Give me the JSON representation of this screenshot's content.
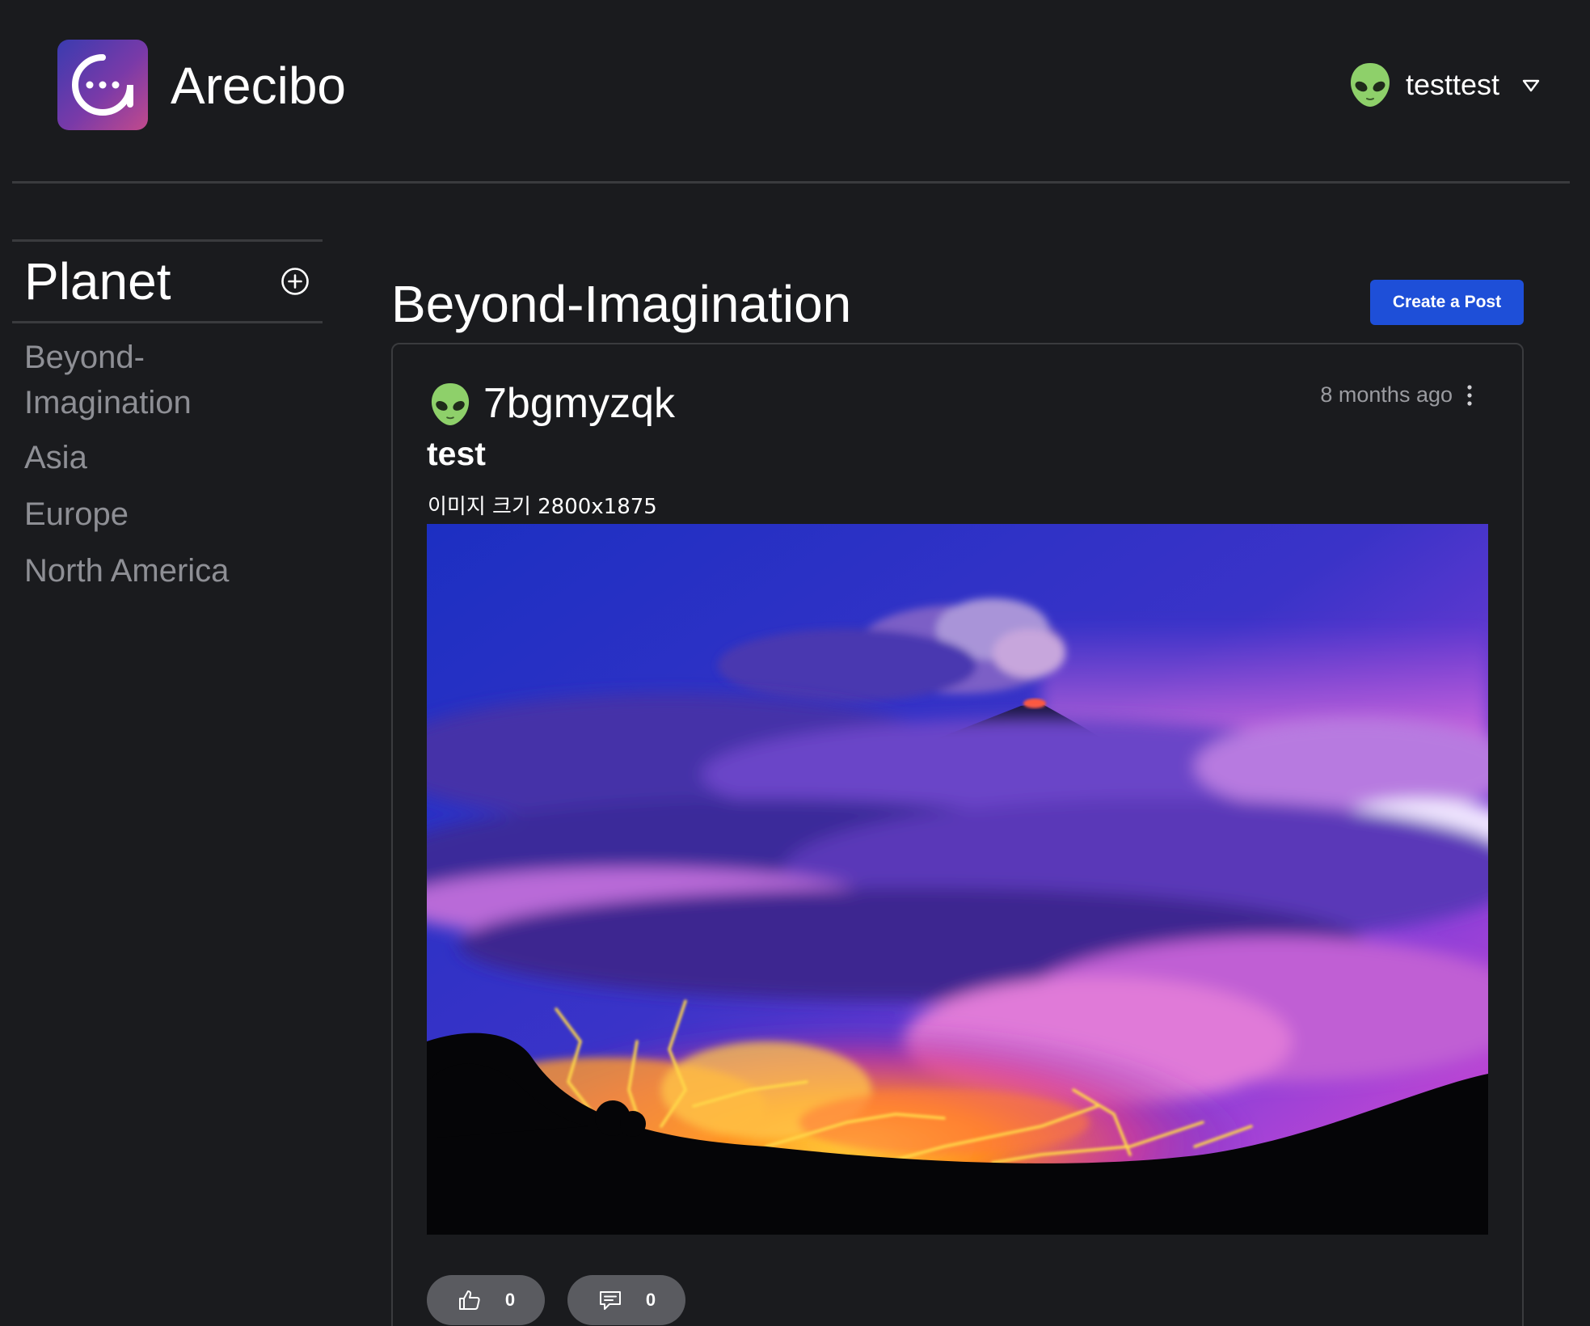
{
  "app": {
    "name": "Arecibo",
    "logo_icon": "chat-bubble-at-icon",
    "brand_gradient": [
      "#3a3bb0",
      "#7a3aa8",
      "#c24a8c"
    ]
  },
  "user": {
    "name": "testtest",
    "avatar_icon": "alien-face-icon",
    "menu_icon": "chevron-down-icon"
  },
  "sidebar": {
    "title": "Planet",
    "add_icon": "plus-circle-icon",
    "items": [
      {
        "label": "Beyond-\nImagination"
      },
      {
        "label": "Asia"
      },
      {
        "label": "Europe"
      },
      {
        "label": "North America"
      }
    ]
  },
  "main": {
    "title": "Beyond-Imagination",
    "create_button": "Create a Post",
    "accent": "#1e4fd8"
  },
  "post": {
    "author": "7bgmyzqk",
    "author_avatar_icon": "alien-face-icon",
    "timestamp": "8 months ago",
    "title": "test",
    "body": "이미지 크기 2800x1875",
    "image_subject": "volcano erupting at dusk above purple clouds with glowing lava flows",
    "likes": "0",
    "comments": "0"
  }
}
